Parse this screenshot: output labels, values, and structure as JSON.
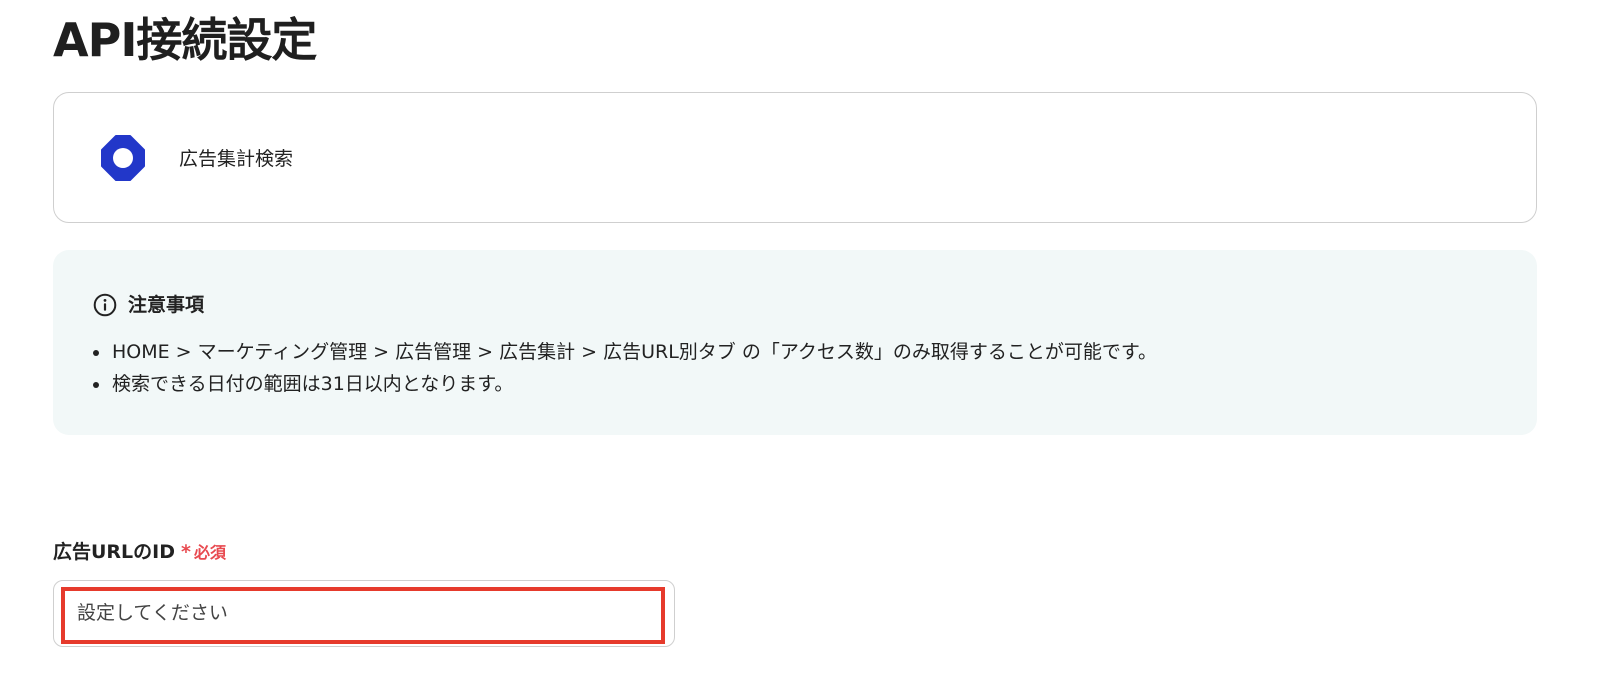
{
  "page": {
    "title": "API接続設定"
  },
  "app": {
    "name": "広告集計検索",
    "logo_icon": "octagon-ring-logo-icon",
    "brand_color": "#2237c9"
  },
  "notice": {
    "icon": "info-icon",
    "title": "注意事項",
    "items": [
      "HOME > マーケティング管理 > 広告管理 > 広告集計 > 広告URL別タブ の「アクセス数」のみ取得することが可能です。",
      "検索できる日付の範囲は31日以内となります。"
    ],
    "background_color": "#f2f8f8"
  },
  "form": {
    "ad_url_id": {
      "label": "広告URLのID",
      "required_mark": "*",
      "required_text": "必須",
      "placeholder": "設定してください",
      "value": ""
    }
  },
  "colors": {
    "required": "#e84a50",
    "highlight": "#e63a2c"
  }
}
